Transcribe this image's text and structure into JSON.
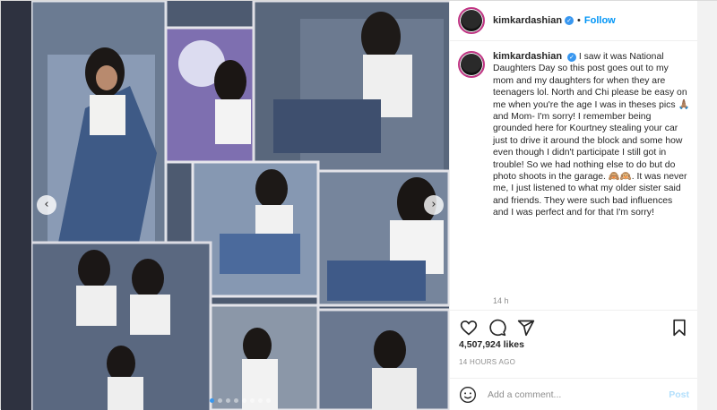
{
  "post": {
    "username": "kimkardashian",
    "verified_mark": "✓",
    "separator": "•",
    "follow_label": "Follow",
    "caption_text": "I saw it was National Daughters Day so this post goes out to my mom and my daughters for when they are teenagers lol. North and Chi please be easy on me when you're the age I was in theses pics 🙏🏽 and Mom- I'm sorry! I remember being grounded here for Kourtney stealing your car just to drive it around the block and some how even though I didn't participate I still got in trouble! So we had nothing else to do but do photo shoots in the garage. 🙈🙉. It was never me, I just listened to what my older sister said and friends. They were such bad influences and I was perfect and for that I'm sorry!",
    "caption_time": "14 h",
    "likes": "4,507,924 likes",
    "posted_ago": "14 HOURS AGO",
    "comment_placeholder": "Add a comment...",
    "post_label": "Post"
  },
  "carousel": {
    "prev_arrow": "‹",
    "next_arrow": "›",
    "dot_count": 8,
    "active_dot": 0
  },
  "icons": {
    "like": "heart-icon",
    "comment": "comment-icon",
    "share": "share-icon",
    "save": "bookmark-icon",
    "emoji": "smiley-icon"
  },
  "colors": {
    "link": "#0095f6",
    "muted": "#8e8e8e",
    "text": "#262626",
    "post_disabled": "#b2dffc"
  }
}
